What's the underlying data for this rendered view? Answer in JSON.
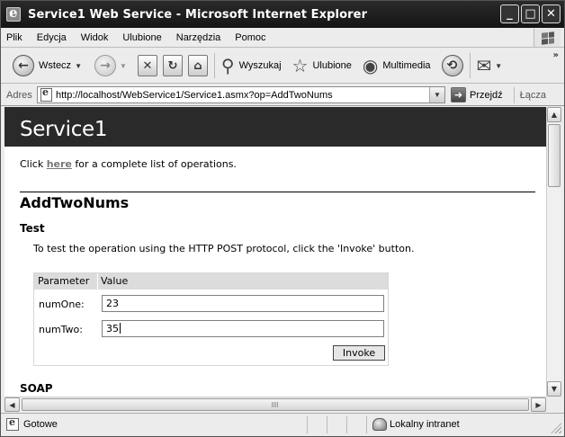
{
  "window": {
    "title": "Service1 Web Service - Microsoft Internet Explorer",
    "controls": {
      "minimize": "_",
      "maximize": "□",
      "close": "✕"
    }
  },
  "menu": [
    "Plik",
    "Edycja",
    "Widok",
    "Ulubione",
    "Narzędzia",
    "Pomoc"
  ],
  "toolbar": {
    "back_label": "Wstecz",
    "search_label": "Wyszukaj",
    "favorites_label": "Ulubione",
    "multimedia_label": "Multimedia",
    "overflow": "»"
  },
  "address": {
    "label": "Adres",
    "url": "http://localhost/WebService1/Service1.asmx?op=AddTwoNums",
    "go_label": "Przejdź",
    "links_label": "Łącza"
  },
  "page": {
    "header_title": "Service1",
    "intro_before": "Click ",
    "intro_link": "here",
    "intro_after": " for a complete list of operations.",
    "operation": "AddTwoNums",
    "test_heading": "Test",
    "test_description": "To test the operation using the HTTP POST protocol, click the 'Invoke' button.",
    "table_header": {
      "parameter": "Parameter",
      "value": "Value"
    },
    "params": [
      {
        "name": "numOne:",
        "value": "23"
      },
      {
        "name": "numTwo:",
        "value": "35"
      }
    ],
    "invoke_label": "Invoke",
    "soap_heading": "SOAP"
  },
  "status": {
    "text": "Gotowe",
    "zone": "Lokalny intranet"
  },
  "icons": {
    "back": "back-arrow-icon",
    "forward": "forward-arrow-icon",
    "stop": "stop-icon",
    "refresh": "refresh-icon",
    "home": "home-icon",
    "search": "magnifier-icon",
    "favorites": "star-icon",
    "multimedia": "multimedia-icon",
    "history": "history-icon",
    "mail": "mail-icon"
  }
}
